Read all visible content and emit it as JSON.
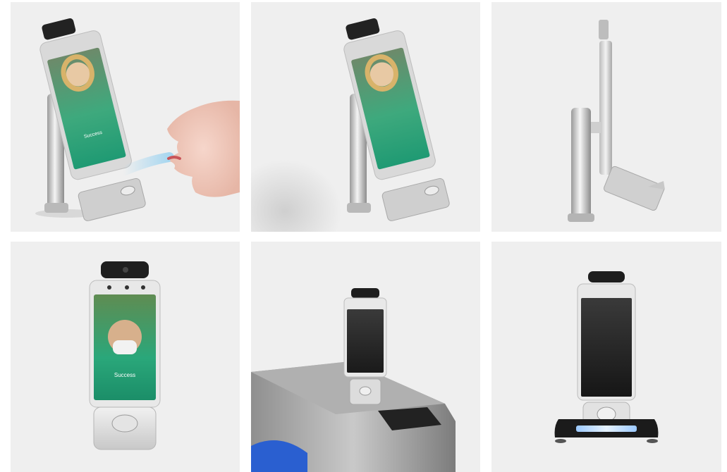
{
  "gallery": {
    "screen_status_text": "Success"
  }
}
